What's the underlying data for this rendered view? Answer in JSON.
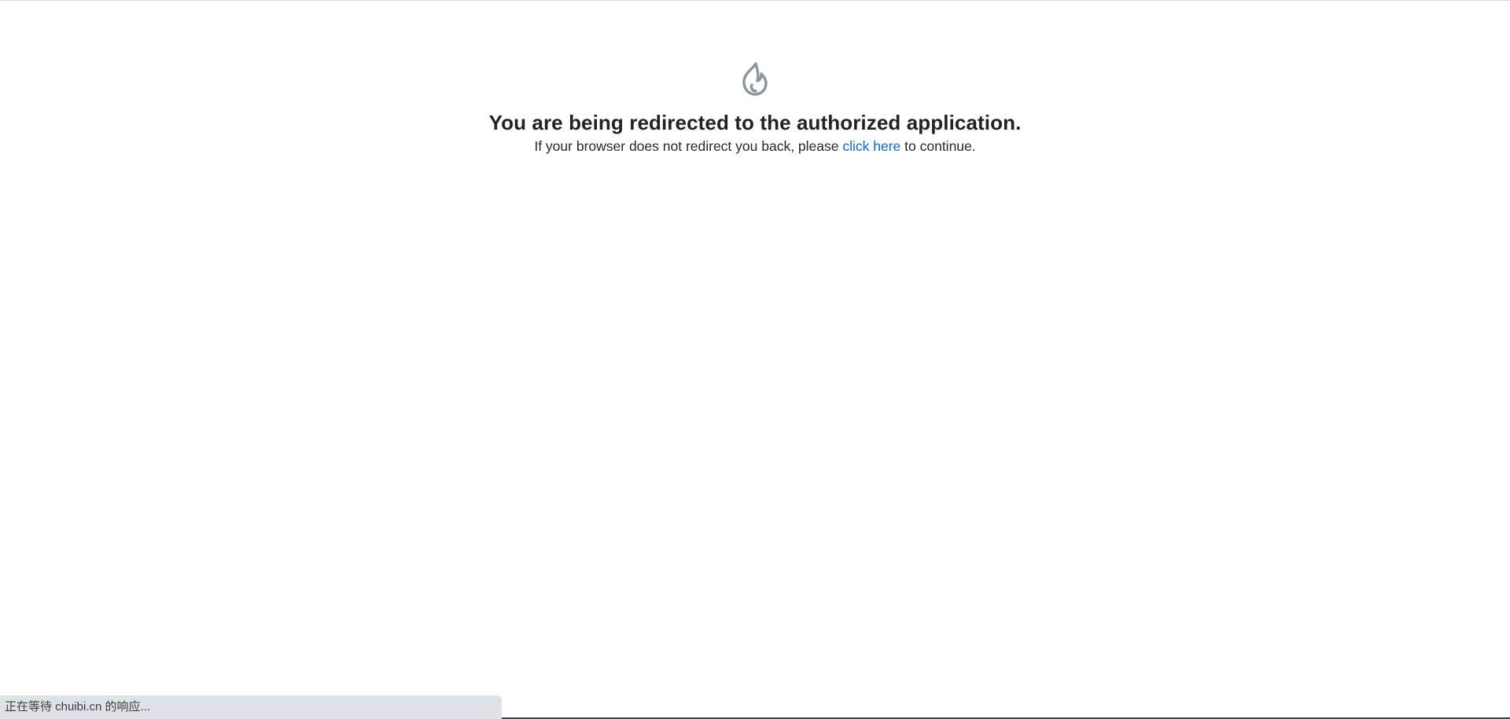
{
  "icon": "flame-icon",
  "colors": {
    "icon": "#8c959f",
    "link": "#0969da",
    "heading": "#1f2328",
    "statusbar_bg": "#dee1e6"
  },
  "heading": "You are being redirected to the authorized application.",
  "message": {
    "before": "If your browser does not redirect you back, please ",
    "link": "click here",
    "after": " to continue."
  },
  "status_bar": {
    "text": "正在等待 chuibi.cn 的响应..."
  }
}
